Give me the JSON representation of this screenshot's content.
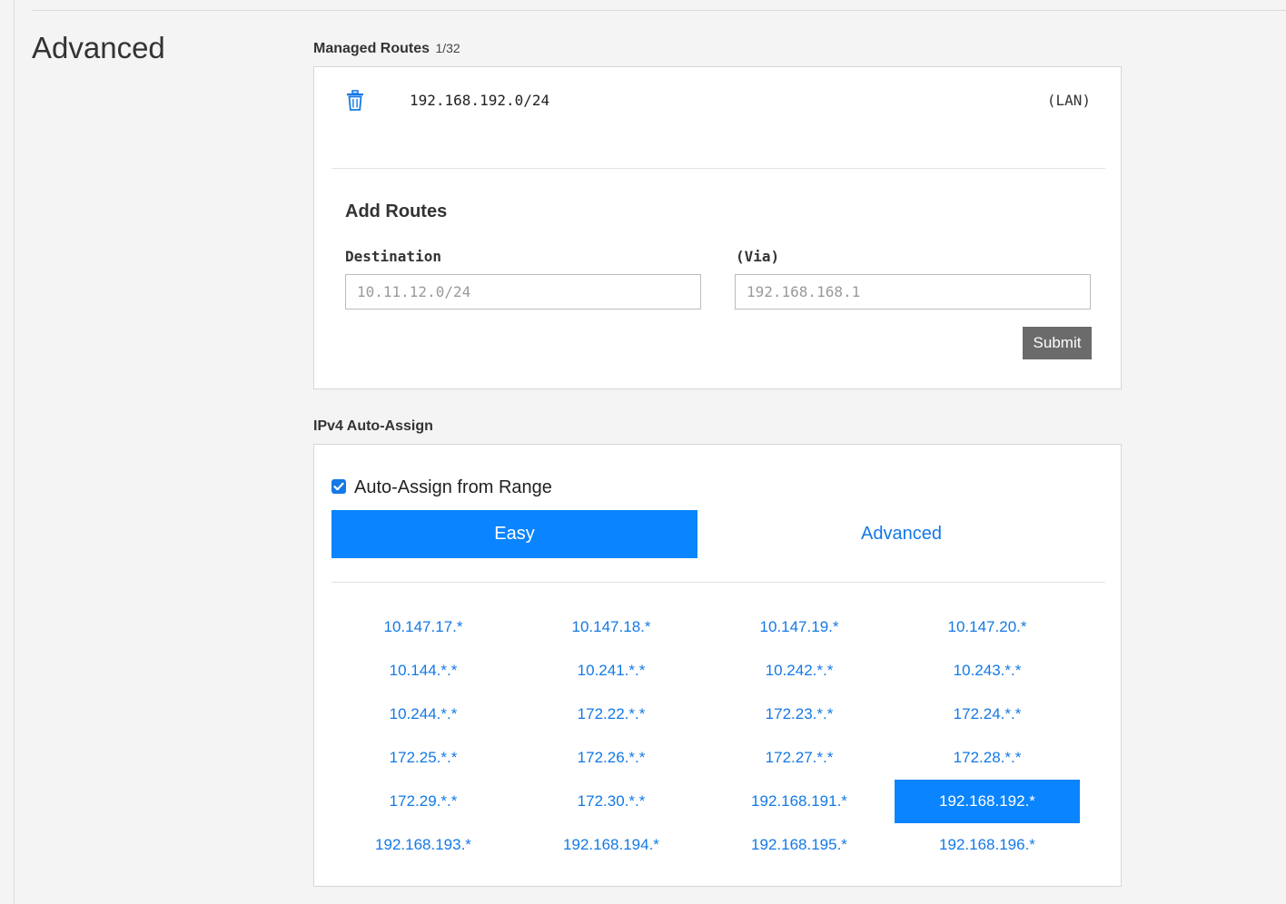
{
  "section": {
    "title": "Advanced"
  },
  "managed_routes": {
    "label": "Managed Routes",
    "count": "1/32",
    "routes": [
      {
        "destination": "192.168.192.0/24",
        "via": "(LAN)"
      }
    ]
  },
  "add_routes": {
    "title": "Add Routes",
    "destination_label": "Destination",
    "destination_placeholder": "10.11.12.0/24",
    "via_label": "(Via)",
    "via_placeholder": "192.168.168.1",
    "submit_label": "Submit"
  },
  "ipv4_auto_assign": {
    "label": "IPv4 Auto-Assign",
    "checkbox_label": "Auto-Assign from Range",
    "checked": true,
    "tabs": {
      "easy": "Easy",
      "advanced": "Advanced",
      "active": "easy"
    },
    "ranges": [
      "10.147.17.*",
      "10.147.18.*",
      "10.147.19.*",
      "10.147.20.*",
      "10.144.*.*",
      "10.241.*.*",
      "10.242.*.*",
      "10.243.*.*",
      "10.244.*.*",
      "172.22.*.*",
      "172.23.*.*",
      "172.24.*.*",
      "172.25.*.*",
      "172.26.*.*",
      "172.27.*.*",
      "172.28.*.*",
      "172.29.*.*",
      "172.30.*.*",
      "192.168.191.*",
      "192.168.192.*",
      "192.168.193.*",
      "192.168.194.*",
      "192.168.195.*",
      "192.168.196.*"
    ],
    "selected_range": "192.168.192.*"
  },
  "colors": {
    "accent": "#0a84ff",
    "link": "#1479e6",
    "submit_bg": "#6b6b6b"
  }
}
